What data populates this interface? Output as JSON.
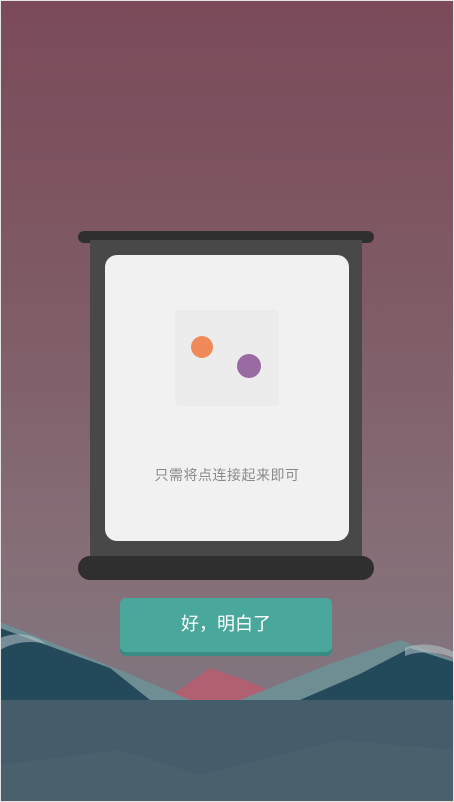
{
  "tutorial": {
    "instruction": "只需将点连接起来即可"
  },
  "actions": {
    "confirm_label": "好，明白了"
  },
  "colors": {
    "background_top": "#7b4a5a",
    "background_bottom": "#7a7b84",
    "card": "#f1f1f1",
    "scroll": "#484848",
    "dot_orange": "#f08a5b",
    "dot_purple": "#9a6aa3",
    "button": "#4aa79c",
    "mountains_dark": "#24495a",
    "mountains_light": "#6f8e94",
    "mountains_red": "#b06070",
    "water": "#49616d"
  },
  "icons": [
    "orange-dot-icon",
    "purple-dot-icon"
  ]
}
